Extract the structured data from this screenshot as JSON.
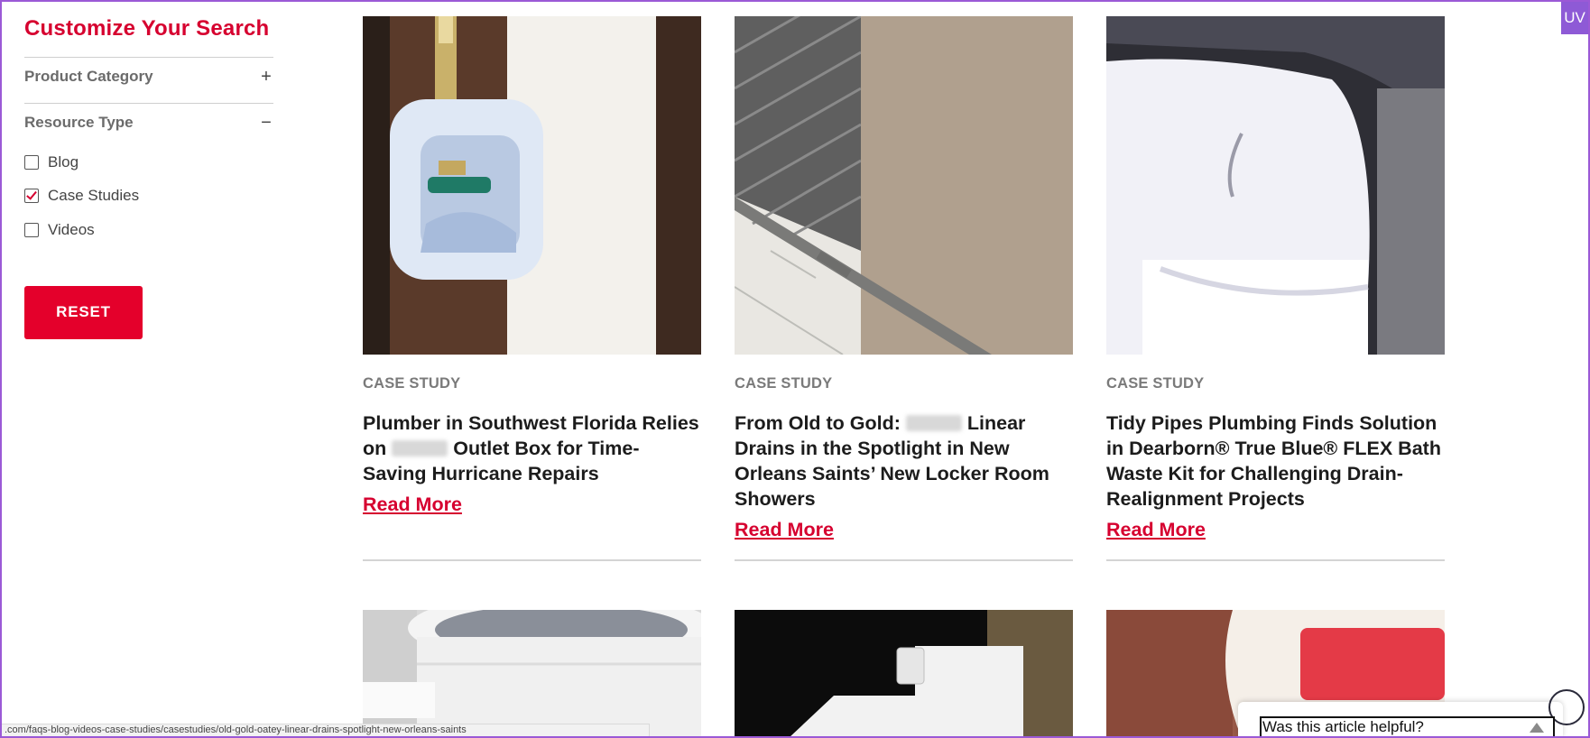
{
  "sidebar": {
    "title": "Customize Your Search",
    "sections": [
      {
        "label": "Product Category",
        "toggle": "+"
      },
      {
        "label": "Resource Type",
        "toggle": "−"
      }
    ],
    "options": [
      {
        "label": "Blog",
        "checked": false
      },
      {
        "label": "Case Studies",
        "checked": true
      },
      {
        "label": "Videos",
        "checked": false
      }
    ],
    "reset_label": "RESET"
  },
  "cards": [
    {
      "label": "CASE STUDY",
      "title_part1": "Plumber in Southwest Florida Relies on",
      "title_part2": "Outlet Box for Time-Saving Hurricane Repairs",
      "read_more": "Read More",
      "image": "outlet-box-photo"
    },
    {
      "label": "CASE STUDY",
      "title_part1": "From Old to Gold:",
      "title_part2": "Linear Drains in the Spotlight in New Orleans Saints’ New Locker Room Showers",
      "read_more": "Read More",
      "image": "linear-drain-photo"
    },
    {
      "label": "CASE STUDY",
      "title_part1": "Tidy Pipes Plumbing Finds Solution in Dearborn® True Blue® FLEX Bath Waste Kit for Challenging Drain-Realignment Projects",
      "title_part2": "",
      "read_more": "Read More",
      "image": "pipe-fitting-photo"
    }
  ],
  "bottom_images": [
    "bucket-photo",
    "box-photo",
    "product-can-photo"
  ],
  "status_url": ".com/faqs-blog-videos-case-studies/casestudies/old-gold-oatey-linear-drains-spotlight-new-orleans-saints",
  "feedback": {
    "label": "Was this article helpful?"
  },
  "uv_badge": "UV",
  "colors": {
    "accent": "#e4002b",
    "title_red": "#d6002f",
    "frame": "#9b59d6"
  }
}
